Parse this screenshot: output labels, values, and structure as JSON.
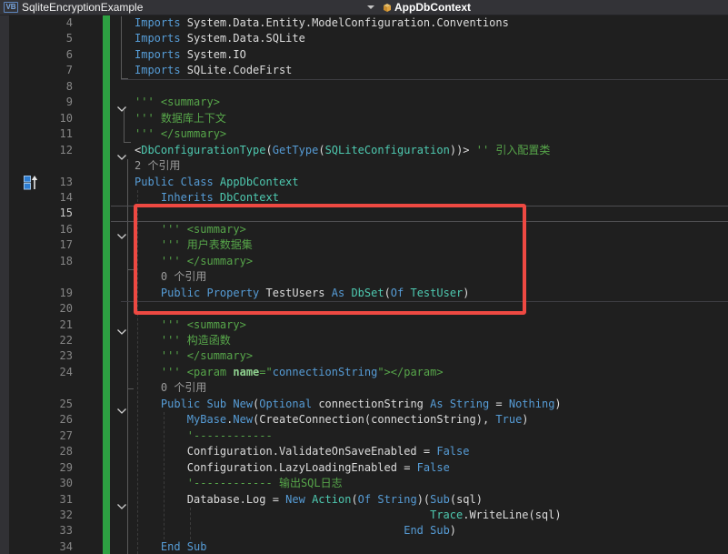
{
  "navbar": {
    "project_icon_label": "VB",
    "project_name": "SqliteEncryptionExample",
    "member_name": "AppDbContext"
  },
  "annotation": {
    "highlight_box_color": "#ee4942",
    "purpose": "highlights summary comment and TestUsers property (lines 15-19)"
  },
  "colors": {
    "background": "#1f1f1f",
    "keyword": "#569cd6",
    "type": "#4ec9b0",
    "plain": "#dcdcdc",
    "comment": "#57a64a",
    "change_bar": "#2da042"
  },
  "editor": {
    "rows": [
      {
        "n": "4",
        "seg": [
          [
            "kw",
            "Imports"
          ],
          [
            "pl",
            " System.Data.Entity.ModelConfiguration.Conventions"
          ]
        ]
      },
      {
        "n": "5",
        "seg": [
          [
            "kw",
            "Imports"
          ],
          [
            "pl",
            " System.Data.SQLite"
          ]
        ]
      },
      {
        "n": "6",
        "seg": [
          [
            "kw",
            "Imports"
          ],
          [
            "pl",
            " System.IO"
          ]
        ]
      },
      {
        "n": "7",
        "seg": [
          [
            "kw",
            "Imports"
          ],
          [
            "pl",
            " SQLite.CodeFirst"
          ]
        ]
      },
      {
        "n": "8",
        "seg": []
      },
      {
        "n": "9",
        "fold": true,
        "seg": [
          [
            "cmt",
            "''' <summary>"
          ]
        ]
      },
      {
        "n": "10",
        "seg": [
          [
            "cmt",
            "''' 数据库上下文"
          ]
        ]
      },
      {
        "n": "11",
        "seg": [
          [
            "cmt",
            "''' </summary>"
          ]
        ]
      },
      {
        "n": "12",
        "fold": true,
        "seg": [
          [
            "pl",
            "<"
          ],
          [
            "typ",
            "DbConfigurationType"
          ],
          [
            "pl",
            "("
          ],
          [
            "kw",
            "GetType"
          ],
          [
            "pl",
            "("
          ],
          [
            "typ",
            "SQLiteConfiguration"
          ],
          [
            "pl",
            "))> "
          ],
          [
            "cmt",
            "'' 引入配置类"
          ]
        ]
      },
      {
        "lens": "2 个引用",
        "col": 0
      },
      {
        "n": "13",
        "icon": "inheritance",
        "seg": [
          [
            "kw",
            "Public Class "
          ],
          [
            "typ",
            "AppDbContext"
          ]
        ]
      },
      {
        "n": "14",
        "seg": [
          [
            "kw",
            "    Inherits "
          ],
          [
            "typ",
            "DbContext"
          ]
        ]
      },
      {
        "n": "15",
        "cur": true,
        "seg": []
      },
      {
        "n": "16",
        "fold": true,
        "seg": [
          [
            "cmt",
            "    ''' <summary>"
          ]
        ]
      },
      {
        "n": "17",
        "seg": [
          [
            "cmt",
            "    ''' 用户表数据集"
          ]
        ]
      },
      {
        "n": "18",
        "seg": [
          [
            "cmt",
            "    ''' </summary>"
          ]
        ]
      },
      {
        "lens": "0 个引用",
        "col": 4
      },
      {
        "n": "19",
        "seg": [
          [
            "kw",
            "    Public Property "
          ],
          [
            "pl",
            "TestUsers "
          ],
          [
            "kw",
            "As "
          ],
          [
            "typ",
            "DbSet"
          ],
          [
            "pl",
            "("
          ],
          [
            "kw",
            "Of "
          ],
          [
            "typ",
            "TestUser"
          ],
          [
            "pl",
            ")"
          ]
        ]
      },
      {
        "n": "20",
        "seg": []
      },
      {
        "n": "21",
        "fold": true,
        "seg": [
          [
            "cmt",
            "    ''' <summary>"
          ]
        ]
      },
      {
        "n": "22",
        "seg": [
          [
            "cmt",
            "    ''' 构造函数"
          ]
        ]
      },
      {
        "n": "23",
        "seg": [
          [
            "cmt",
            "    ''' </summary>"
          ]
        ]
      },
      {
        "n": "24",
        "seg": [
          [
            "cmt",
            "    ''' <param "
          ],
          [
            "xa",
            "name"
          ],
          [
            "cmt",
            "=\""
          ],
          [
            "av",
            "connectionString"
          ],
          [
            "cmt",
            "\"></param>"
          ]
        ]
      },
      {
        "lens": "0 个引用",
        "col": 4
      },
      {
        "n": "25",
        "fold": true,
        "seg": [
          [
            "kw",
            "    Public Sub New"
          ],
          [
            "pl",
            "("
          ],
          [
            "kw",
            "Optional "
          ],
          [
            "pl",
            "connectionString "
          ],
          [
            "kw",
            "As String "
          ],
          [
            "pl",
            "= "
          ],
          [
            "kw",
            "Nothing"
          ],
          [
            "pl",
            ")"
          ]
        ]
      },
      {
        "n": "26",
        "seg": [
          [
            "kw",
            "        MyBase"
          ],
          [
            "pl",
            "."
          ],
          [
            "kw",
            "New"
          ],
          [
            "pl",
            "(CreateConnection(connectionString), "
          ],
          [
            "kw",
            "True"
          ],
          [
            "pl",
            ")"
          ]
        ]
      },
      {
        "n": "27",
        "seg": [
          [
            "cmt",
            "        '------------"
          ]
        ]
      },
      {
        "n": "28",
        "seg": [
          [
            "pl",
            "        Configuration.ValidateOnSaveEnabled = "
          ],
          [
            "kw",
            "False"
          ]
        ]
      },
      {
        "n": "29",
        "seg": [
          [
            "pl",
            "        Configuration.LazyLoadingEnabled = "
          ],
          [
            "kw",
            "False"
          ]
        ]
      },
      {
        "n": "30",
        "seg": [
          [
            "cmt",
            "        '------------ 输出SQL日志"
          ]
        ]
      },
      {
        "n": "31",
        "fold": true,
        "seg": [
          [
            "pl",
            "        Database.Log = "
          ],
          [
            "kw",
            "New "
          ],
          [
            "typ",
            "Action"
          ],
          [
            "pl",
            "("
          ],
          [
            "kw",
            "Of String"
          ],
          [
            "pl",
            ")("
          ],
          [
            "kw",
            "Sub"
          ],
          [
            "pl",
            "(sql)"
          ]
        ]
      },
      {
        "n": "32",
        "seg": [
          [
            "pl",
            "                                             "
          ],
          [
            "typ",
            "Trace"
          ],
          [
            "pl",
            ".WriteLine(sql)"
          ]
        ]
      },
      {
        "n": "33",
        "seg": [
          [
            "pl",
            "                                         "
          ],
          [
            "kw",
            "End Sub"
          ],
          [
            "pl",
            ")"
          ]
        ]
      },
      {
        "n": "34",
        "seg": [
          [
            "kw",
            "    End Sub"
          ]
        ]
      }
    ]
  }
}
